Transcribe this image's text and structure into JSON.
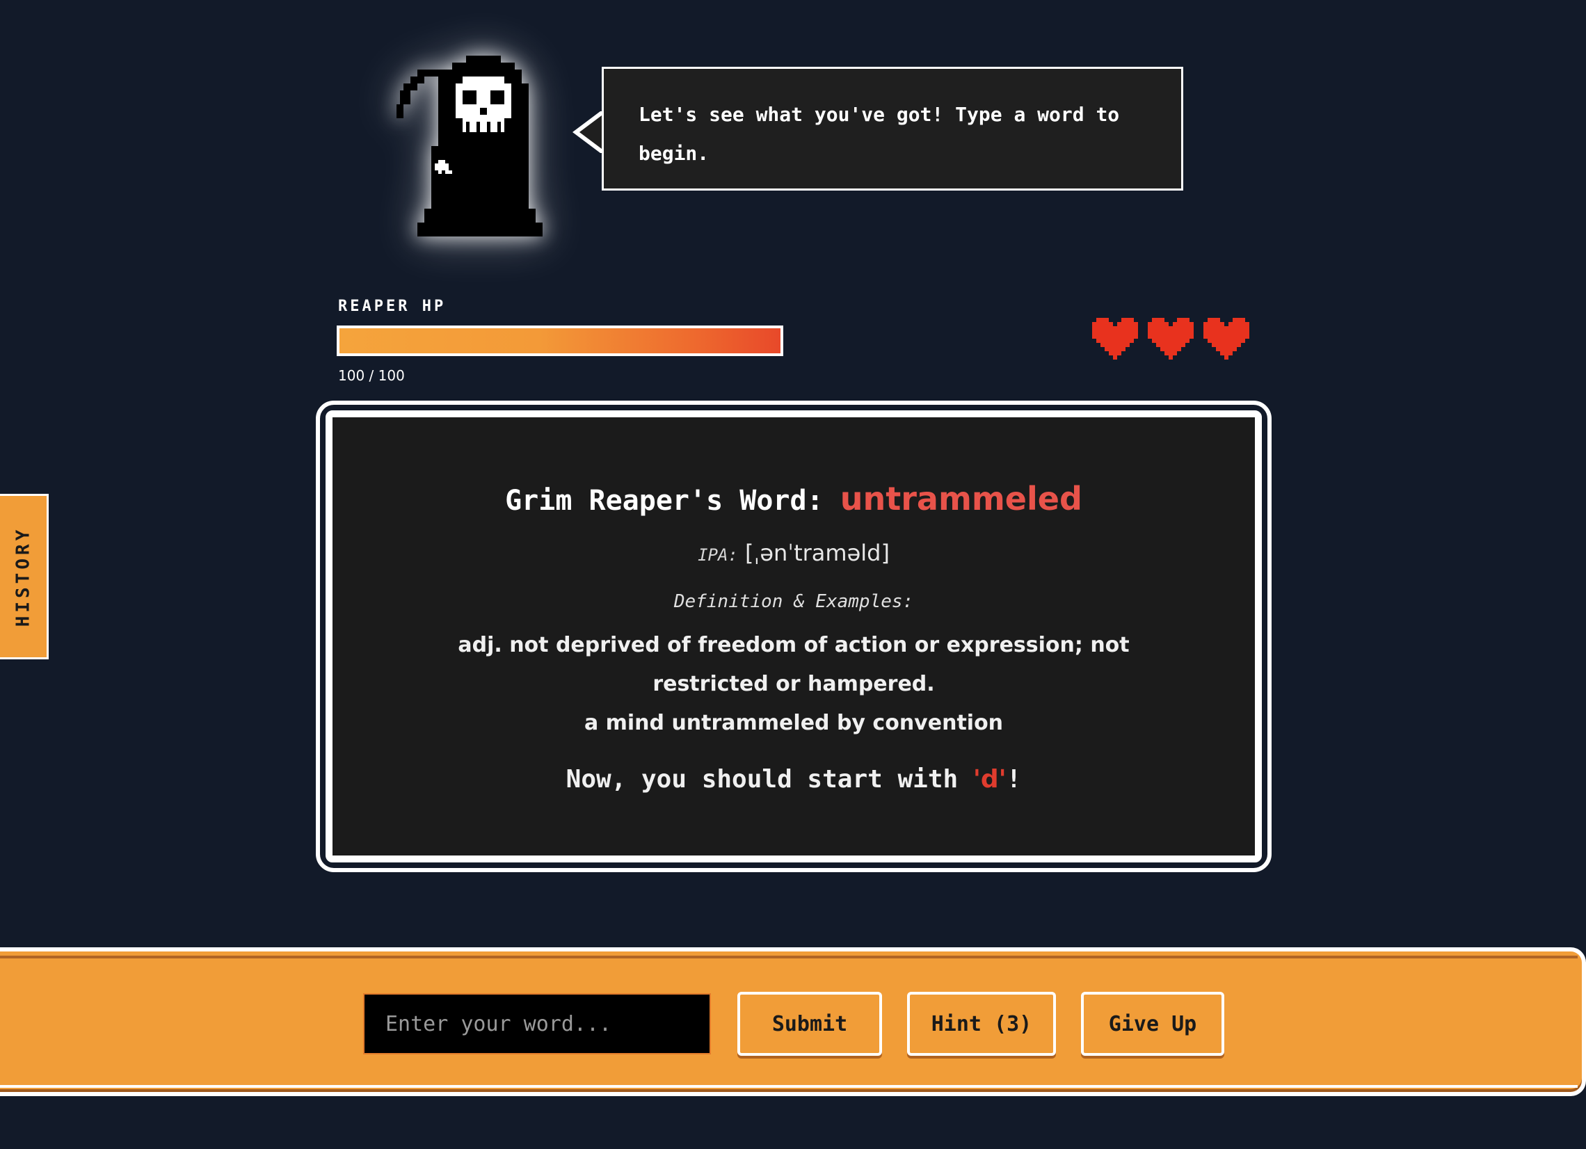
{
  "reaper": {
    "speech": "Let's see what you've got! Type a word to begin."
  },
  "hp": {
    "label": "REAPER HP",
    "current": 100,
    "max": 100,
    "text": "100 / 100",
    "fraction": 1.0
  },
  "lives": {
    "count": 3,
    "icon": "heart-icon",
    "color": "#e8321e"
  },
  "history_tab": {
    "label": "HISTORY"
  },
  "word_panel": {
    "title_prefix": "Grim Reaper's Word: ",
    "word": "untrammeled",
    "ipa_label": "IPA:",
    "ipa_value": "[ˌənˈtraməld]",
    "definition_label": "Definition & Examples:",
    "definition": "adj. not deprived of freedom of action or expression; not restricted or hampered.",
    "example": "a mind untrammeled by convention",
    "instruction_prefix": "Now, you should start with ",
    "next_letter": "'d'",
    "instruction_suffix": "!"
  },
  "controls": {
    "input_placeholder": "Enter your word...",
    "input_value": "",
    "submit_label": "Submit",
    "hint_label": "Hint (3)",
    "give_up_label": "Give Up"
  },
  "colors": {
    "background": "#121a29",
    "accent_orange": "#f19d38",
    "highlight_red": "#e8534a",
    "panel": "#1b1b1b"
  }
}
